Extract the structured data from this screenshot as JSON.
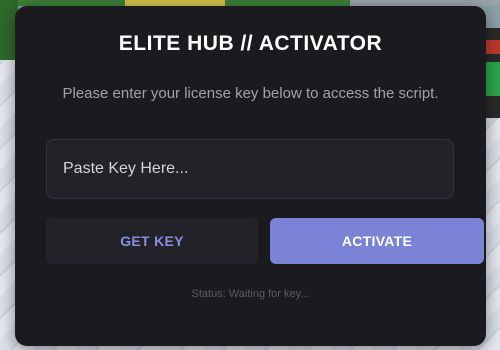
{
  "modal": {
    "title": "ELITE HUB // ACTIVATOR",
    "subtitle": "Please enter your license key below to access the script.",
    "key_input": {
      "value": "",
      "placeholder": "Paste Key Here..."
    },
    "buttons": {
      "get_key": "GET KEY",
      "activate": "ACTIVATE"
    },
    "status": "Status: Waiting for key..."
  },
  "colors": {
    "modal_background": "#1b1a1f",
    "input_background": "#232228",
    "accent": "#7a83d6",
    "get_key_text": "#8a8ee0",
    "subtitle_text": "#a3a2aa",
    "status_text": "#5c5b63"
  }
}
